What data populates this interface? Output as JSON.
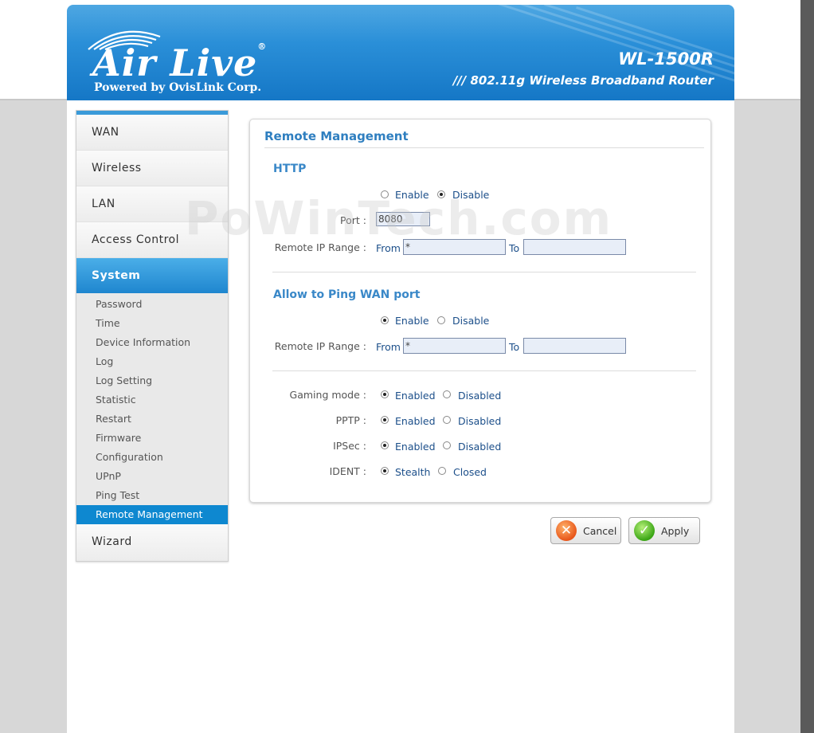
{
  "header": {
    "logo_text": "Air Live",
    "logo_registered": "®",
    "logo_tagline": "Powered by OvisLink Corp.",
    "model": "WL-1500R",
    "model_desc": "/// 802.11g Wireless Broadband Router"
  },
  "watermark": "PoWinTech.com",
  "nav": {
    "main_items": [
      {
        "label": "WAN"
      },
      {
        "label": "Wireless"
      },
      {
        "label": "LAN"
      },
      {
        "label": "Access Control"
      },
      {
        "label": "System"
      }
    ],
    "system_items": [
      {
        "label": "Password"
      },
      {
        "label": "Time"
      },
      {
        "label": "Device Information"
      },
      {
        "label": "Log"
      },
      {
        "label": "Log Setting"
      },
      {
        "label": "Statistic"
      },
      {
        "label": "Restart"
      },
      {
        "label": "Firmware"
      },
      {
        "label": "Configuration"
      },
      {
        "label": "UPnP"
      },
      {
        "label": "Ping Test"
      },
      {
        "label": "Remote Management"
      }
    ],
    "wizard_label": "Wizard"
  },
  "panel": {
    "title": "Remote Management",
    "http": {
      "title": "HTTP",
      "enable_label": "Enable",
      "disable_label": "Disable",
      "selected": "Disable",
      "port_label": "Port :",
      "port_value": "8080",
      "range_label": "Remote IP Range :",
      "from_label": "From",
      "from_value": "*",
      "to_label": "To",
      "to_value": ""
    },
    "ping": {
      "title": "Allow to Ping WAN port",
      "enable_label": "Enable",
      "disable_label": "Disable",
      "selected": "Enable",
      "range_label": "Remote IP Range :",
      "from_label": "From",
      "from_value": "*",
      "to_label": "To",
      "to_value": ""
    },
    "options": [
      {
        "label": "Gaming mode :",
        "opt_a": "Enabled",
        "opt_b": "Disabled",
        "selected": "a"
      },
      {
        "label": "PPTP :",
        "opt_a": "Enabled",
        "opt_b": "Disabled",
        "selected": "a"
      },
      {
        "label": "IPSec :",
        "opt_a": "Enabled",
        "opt_b": "Disabled",
        "selected": "a"
      },
      {
        "label": "IDENT :",
        "opt_a": "Stealth",
        "opt_b": "Closed",
        "selected": "a"
      }
    ]
  },
  "buttons": {
    "cancel_label": "Cancel",
    "apply_label": "Apply"
  }
}
